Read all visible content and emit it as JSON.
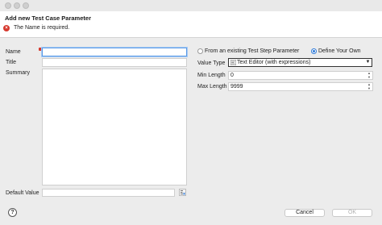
{
  "dialog": {
    "title": "Add new Test Case Parameter",
    "error_message": "The Name is required."
  },
  "form": {
    "name_label": "Name",
    "name_value": "",
    "title_label": "Title",
    "title_value": "",
    "summary_label": "Summary",
    "summary_value": "",
    "default_value_label": "Default Value",
    "default_value": ""
  },
  "source": {
    "option_existing": "From an existing Test Step Parameter",
    "option_own": "Define Your Own",
    "selected": "Define Your Own"
  },
  "value_type": {
    "label": "Value Type",
    "selected": "Text Editor (with expressions)"
  },
  "min_length": {
    "label": "Min Length",
    "value": "0"
  },
  "max_length": {
    "label": "Max Length",
    "value": "9999"
  },
  "buttons": {
    "cancel": "Cancel",
    "ok": "OK"
  },
  "colors": {
    "error": "#d63a2f",
    "focus": "#5a9ae6",
    "radio_selected": "#2f7bd9"
  },
  "icons": [
    "error-icon",
    "expression-icon",
    "help-icon",
    "chevron-down-icon"
  ]
}
